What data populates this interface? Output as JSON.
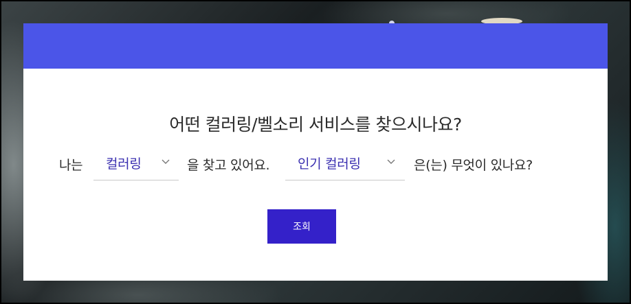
{
  "dialog": {
    "title": "어떤 컬러링/벨소리 서비스를 찾으시나요?"
  },
  "sentence": {
    "prefix": "나는",
    "service_select": {
      "value": "컬러링"
    },
    "middle": "을 찾고 있어요.",
    "category_select": {
      "value": "인기 컬러링"
    },
    "suffix": "은(는) 무엇이 있나요?"
  },
  "search_button": {
    "label": "조회"
  },
  "colors": {
    "header": "#4b55e8",
    "button": "#3421c9",
    "select_text": "#3a2fb0"
  },
  "icons": [
    "chevron-down-icon"
  ]
}
